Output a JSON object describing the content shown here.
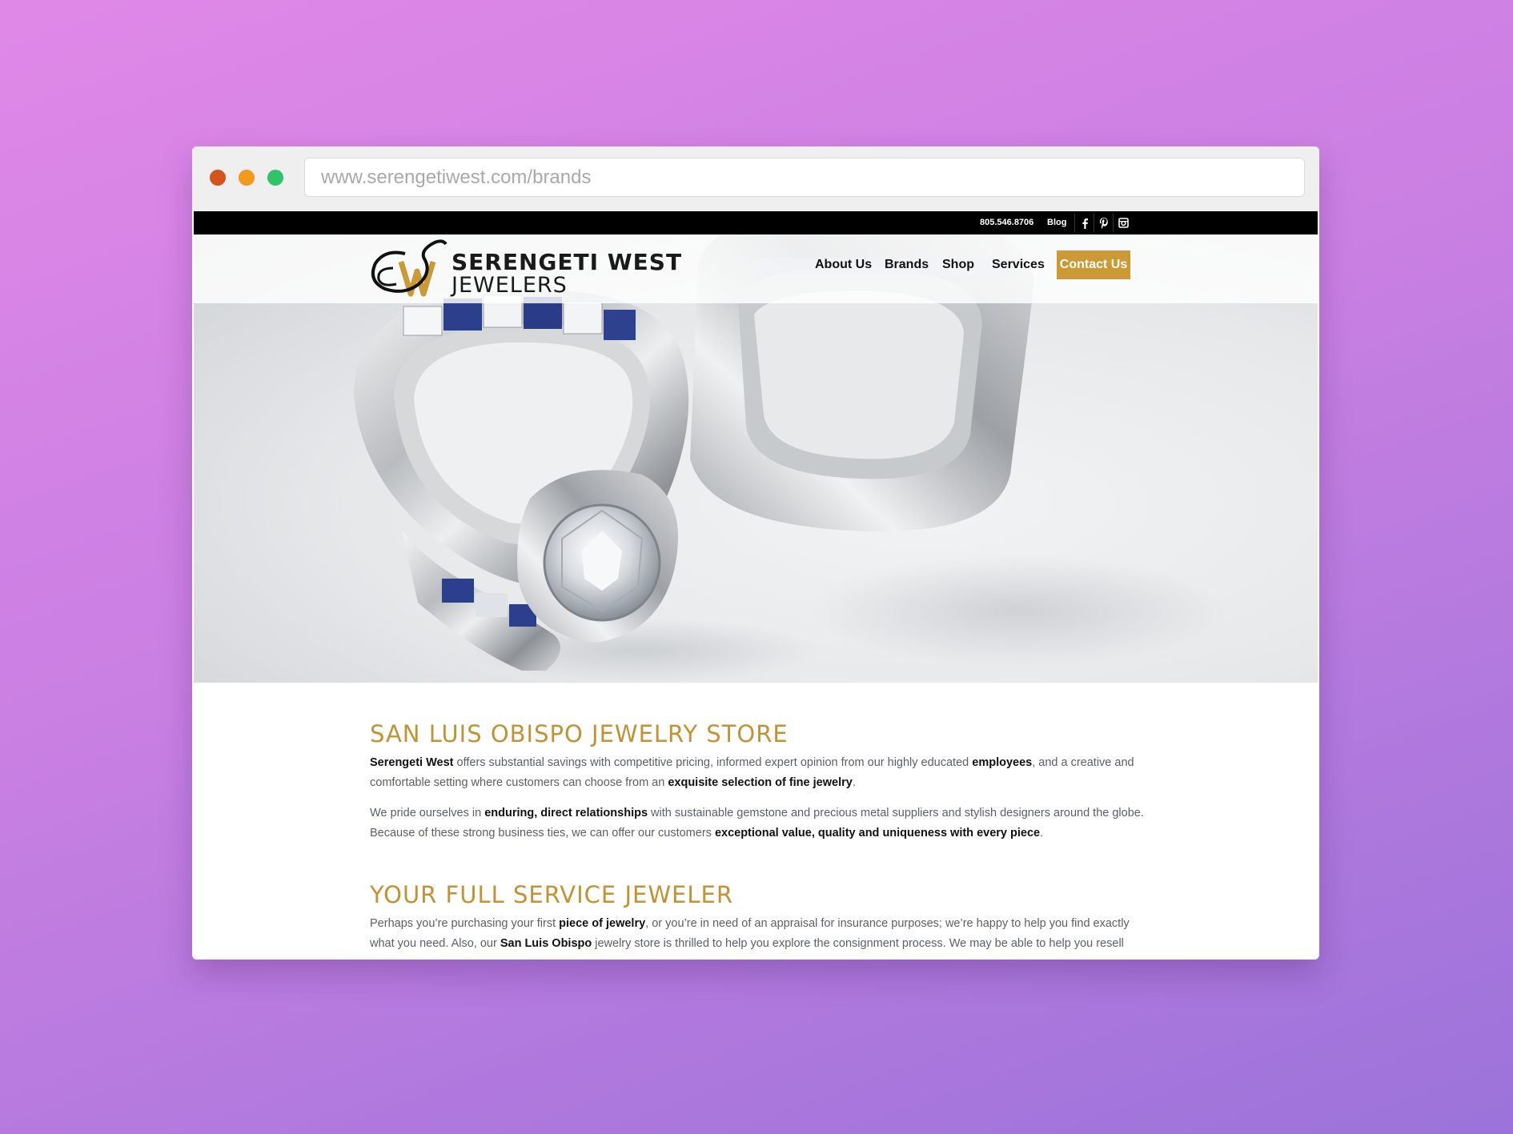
{
  "browser": {
    "url": "www.serengetiwest.com/brands",
    "dots": [
      "#d4541b",
      "#f39a1c",
      "#2ec46a"
    ]
  },
  "topbar": {
    "phone": "805.546.8706",
    "blog": "Blog",
    "social": [
      {
        "name": "facebook-icon"
      },
      {
        "name": "pinterest-icon"
      },
      {
        "name": "instagram-icon"
      }
    ]
  },
  "header": {
    "logo_line1": "SERENGETI WEST",
    "logo_line2": "JEWELERS",
    "nav": [
      {
        "label": "About Us"
      },
      {
        "label": "Brands"
      },
      {
        "label": "Shop"
      },
      {
        "label": "Services"
      }
    ],
    "contact_label": "Contact Us"
  },
  "content": {
    "heading1": "SAN LUIS OBISPO JEWELRY STORE",
    "p1": {
      "a": "Serengeti West",
      "b": " offers substantial savings with competitive pricing, informed expert opinion from our highly educated ",
      "c": "employees",
      "d": ", and a creative and comfortable setting where customers can choose from an ",
      "e": "exquisite selection of fine jewelry",
      "f": "."
    },
    "p2": {
      "a": "We pride ourselves in ",
      "b": "enduring, direct relationships",
      "c": " with sustainable gemstone and precious metal suppliers and stylish designers around the globe. Because of these strong business ties, we can offer our customers ",
      "d": "exceptional value, quality and uniqueness with every piece",
      "e": "."
    },
    "heading2": "YOUR FULL SERVICE JEWELER",
    "p3": {
      "a": "Perhaps you’re purchasing your first ",
      "b": "piece of jewelry",
      "c": ", or you’re in need of an appraisal for insurance purposes; we’re happy to help you find exactly what you need. Also, our ",
      "d": "San Luis Obispo",
      "e": " jewelry store is thrilled to help you explore the consignment process. We may be able to help you resell"
    }
  },
  "colors": {
    "accent_gold": "#cb9a35",
    "heading_gold": "#c39232",
    "topbar_black": "#000000"
  }
}
